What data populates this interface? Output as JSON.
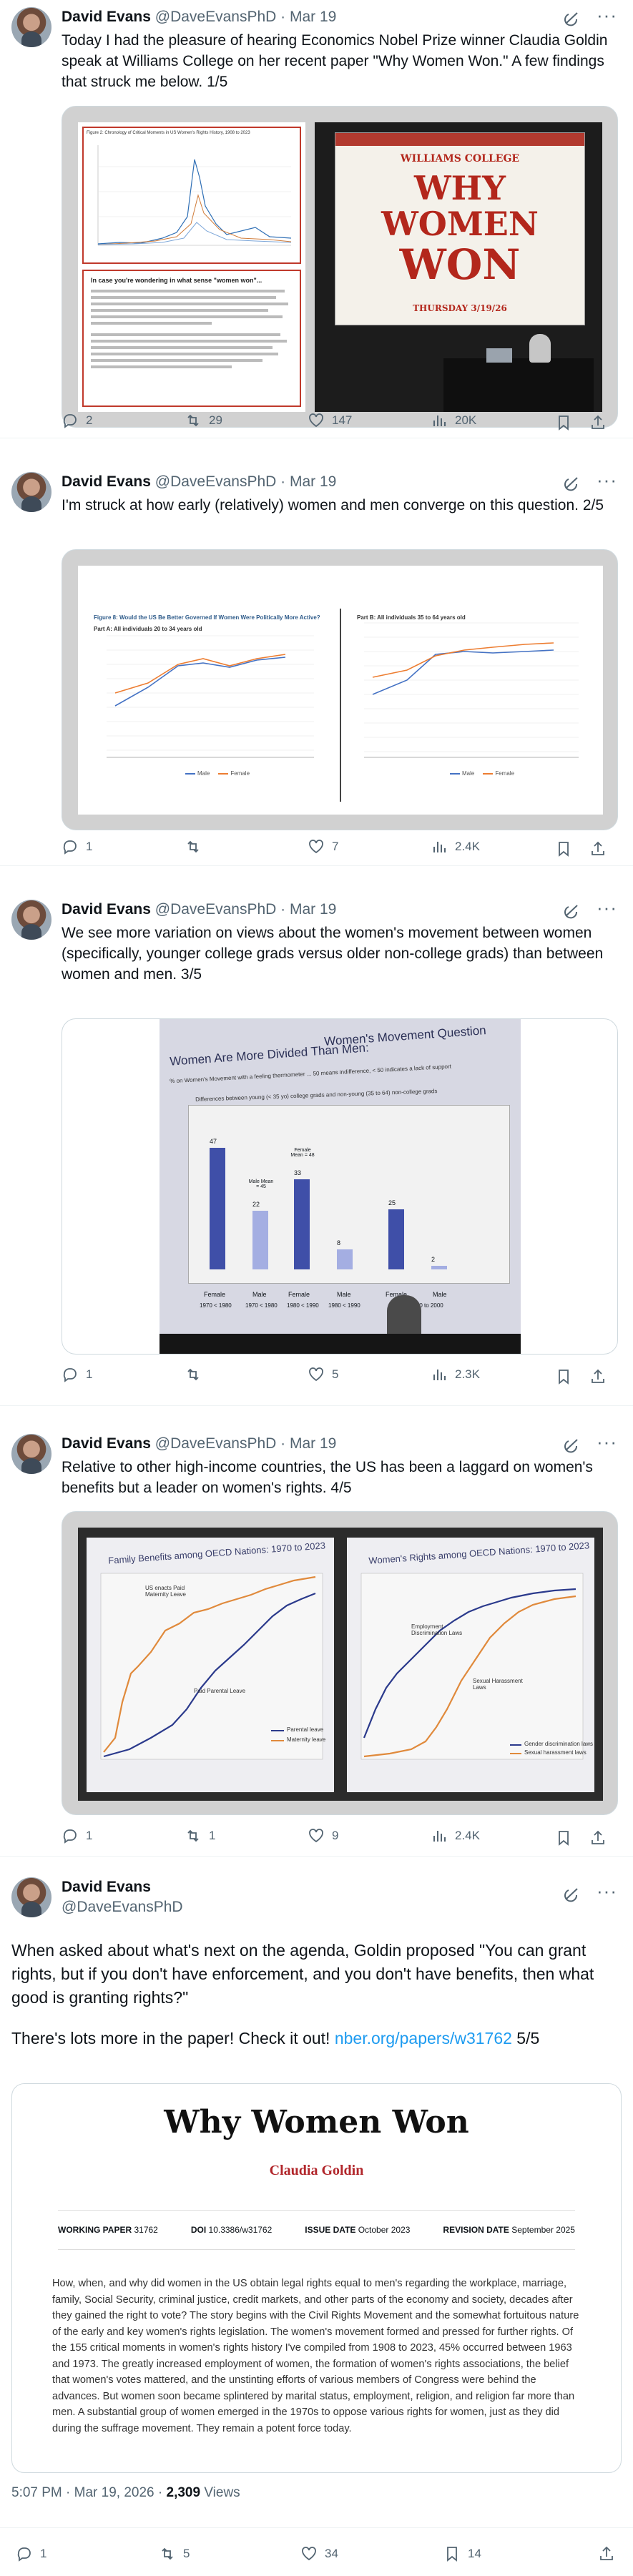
{
  "tweets": [
    {
      "name": "David Evans",
      "handle": "@DaveEvansPhD",
      "dot": "·",
      "date": "Mar 19",
      "text": "Today I had the pleasure of hearing Economics Nobel Prize winner Claudia Goldin speak at Williams College on her recent paper \"Why Women Won.\" A few findings that struck me below. 1/5",
      "replies": "2",
      "reposts": "29",
      "likes": "147",
      "views": "20K"
    },
    {
      "name": "David Evans",
      "handle": "@DaveEvansPhD",
      "dot": "·",
      "date": "Mar 19",
      "text": "I'm struck at how early (relatively) women and men converge on this question. 2/5",
      "replies": "1",
      "reposts": "",
      "likes": "7",
      "views": "2.4K"
    },
    {
      "name": "David Evans",
      "handle": "@DaveEvansPhD",
      "dot": "·",
      "date": "Mar 19",
      "text": "We see more variation on views about the women's movement between women (specifically, younger college grads versus older non-college grads) than between women and men. 3/5",
      "replies": "1",
      "reposts": "",
      "likes": "5",
      "views": "2.3K"
    },
    {
      "name": "David Evans",
      "handle": "@DaveEvansPhD",
      "dot": "·",
      "date": "Mar 19",
      "text": "Relative to other high-income countries, the US has been a laggard on women's benefits but a leader on women's rights. 4/5",
      "replies": "1",
      "reposts": "1",
      "likes": "9",
      "views": "2.4K"
    }
  ],
  "slides": {
    "s1_chart_title": "Figure 2: Chronology of Critical Moments in US Women's Rights History, 1908 to 2023",
    "s1_box_title": "In case you're wondering in what sense \"women won\"...",
    "s1_college": "WILLIAMS COLLEGE",
    "s1_why": "WHY",
    "s1_women": "WOMEN",
    "s1_won": "WON",
    "s1_date": "THURSDAY 3/19/26",
    "s2_title_a": "Figure 8: Would the US Be Better Governed If Women Were Politically More Active?",
    "s2_panel_a": "Part A: All individuals 20 to 34 years old",
    "s2_panel_b": "Part B: All individuals 35 to 64 years old",
    "s2_legend_male": "Male",
    "s2_legend_female": "Female",
    "s3_top": "Women's Movement Question",
    "s3_title": "Women Are More Divided Than Men:",
    "s3_sub": "% on Women's Movement with a feeling thermometer ... 50 means indifference, < 50 indicates a lack of support",
    "s3_diff": "Differences between young (< 35 yo) college grads and non-young (35 to 64) non-college grads",
    "s3_values": [
      "47",
      "22",
      "33",
      "8",
      "25",
      "2"
    ],
    "s3_bar_notes": [
      "Male Mean = 45",
      "Female Mean = 48"
    ],
    "s3_labels": [
      "Female",
      "Male",
      "Female",
      "Male",
      "Female",
      "Male"
    ],
    "s3_years": [
      "1970 < 1980",
      "1970 < 1980",
      "1980 < 1990",
      "1980 < 1990",
      "1990 to 2000"
    ],
    "s4_left_title": "Family Benefits among OECD Nations: 1970 to 2023",
    "s4_right_title": "Women's Rights among OECD Nations: 1970 to 2023",
    "s4_left_legend": [
      "Parental leave",
      "Maternity leave"
    ],
    "s4_right_legend": [
      "Gender discrimination laws",
      "Sexual harassment laws"
    ],
    "s4_left_notes": [
      "US enacts Paid Maternity Leave",
      "Paid Parental Leave"
    ],
    "s4_right_notes": [
      "Employment Discrimination Laws",
      "Sexual Harassment Laws"
    ]
  },
  "tweet5": {
    "name": "David Evans",
    "handle": "@DaveEvansPhD",
    "text": "When asked about what's next on the agenda, Goldin proposed \"You can grant rights, but if you don't have enforcement, and you don't have benefits, then what good is granting rights?\"",
    "text2_prefix": "There's lots more in the paper! Check it out! ",
    "link": "nber.org/papers/w31762",
    "text2_suffix": " 5/5"
  },
  "paper": {
    "title": "Why Women Won",
    "author": "Claudia Goldin",
    "wp_label": "WORKING PAPER",
    "wp_value": "31762",
    "doi_label": "DOI",
    "doi_value": "10.3386/w31762",
    "issue_label": "ISSUE DATE",
    "issue_value": "October 2023",
    "rev_label": "REVISION DATE",
    "rev_value": "September 2025",
    "abstract": "How, when, and why did women in the US obtain legal rights equal to men's regarding the workplace, marriage, family, Social Security, criminal justice, credit markets, and other parts of the economy and society, decades after they gained the right to vote? The story begins with the Civil Rights Movement and the somewhat fortuitous nature of the early and key women's rights legislation. The women's movement formed and pressed for further rights. Of the 155 critical moments in women's rights history I've compiled from 1908 to 2023, 45% occurred between 1963 and 1973. The greatly increased employment of women, the formation of women's rights associations, the belief that women's votes mattered, and the unstinting efforts of various members of Congress were behind the advances. But women soon became splintered by marital status, employment, religion, and religion far more than men. A substantial group of women emerged in the 1970s to oppose various rights for women, just as they did during the suffrage movement. They remain a potent force today."
  },
  "footer": {
    "time": "5:07 PM · Mar 19, 2026 · ",
    "views_count": "2,309",
    "views_label": " Views",
    "replies": "1",
    "reposts": "5",
    "likes": "34",
    "bookmarks": "14"
  },
  "colors": {
    "link": "#1d9bf0",
    "muted": "#536471",
    "text": "#0f1419",
    "maroon": "#b3271c"
  }
}
